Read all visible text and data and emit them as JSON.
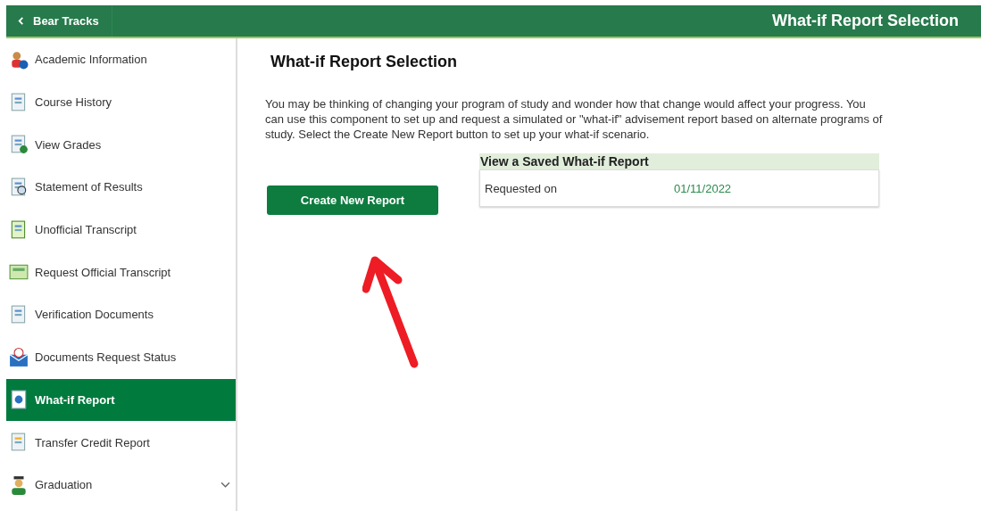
{
  "header": {
    "back_label": "Bear Tracks",
    "title": "What-if Report Selection"
  },
  "sidebar": {
    "items": [
      {
        "label": "Academic Information",
        "selected": false
      },
      {
        "label": "Course History",
        "selected": false
      },
      {
        "label": "View Grades",
        "selected": false
      },
      {
        "label": "Statement of Results",
        "selected": false
      },
      {
        "label": "Unofficial Transcript",
        "selected": false
      },
      {
        "label": "Request Official Transcript",
        "selected": false
      },
      {
        "label": "Verification Documents",
        "selected": false
      },
      {
        "label": "Documents Request Status",
        "selected": false
      },
      {
        "label": "What-if Report",
        "selected": true
      },
      {
        "label": "Transfer Credit Report",
        "selected": false
      },
      {
        "label": "Graduation",
        "selected": false,
        "expandable": true
      }
    ]
  },
  "main": {
    "heading": "What-if Report Selection",
    "description": "You may be thinking of changing your program of study and wonder how that change would affect your progress. You can use this component to set up and request a simulated or \"what-if\" advisement report based on alternate programs of study. Select the Create New Report button to set up your what-if scenario.",
    "create_button": "Create New Report",
    "saved": {
      "title": "View a Saved What-if Report",
      "label": "Requested on",
      "date": "01/11/2022"
    }
  }
}
